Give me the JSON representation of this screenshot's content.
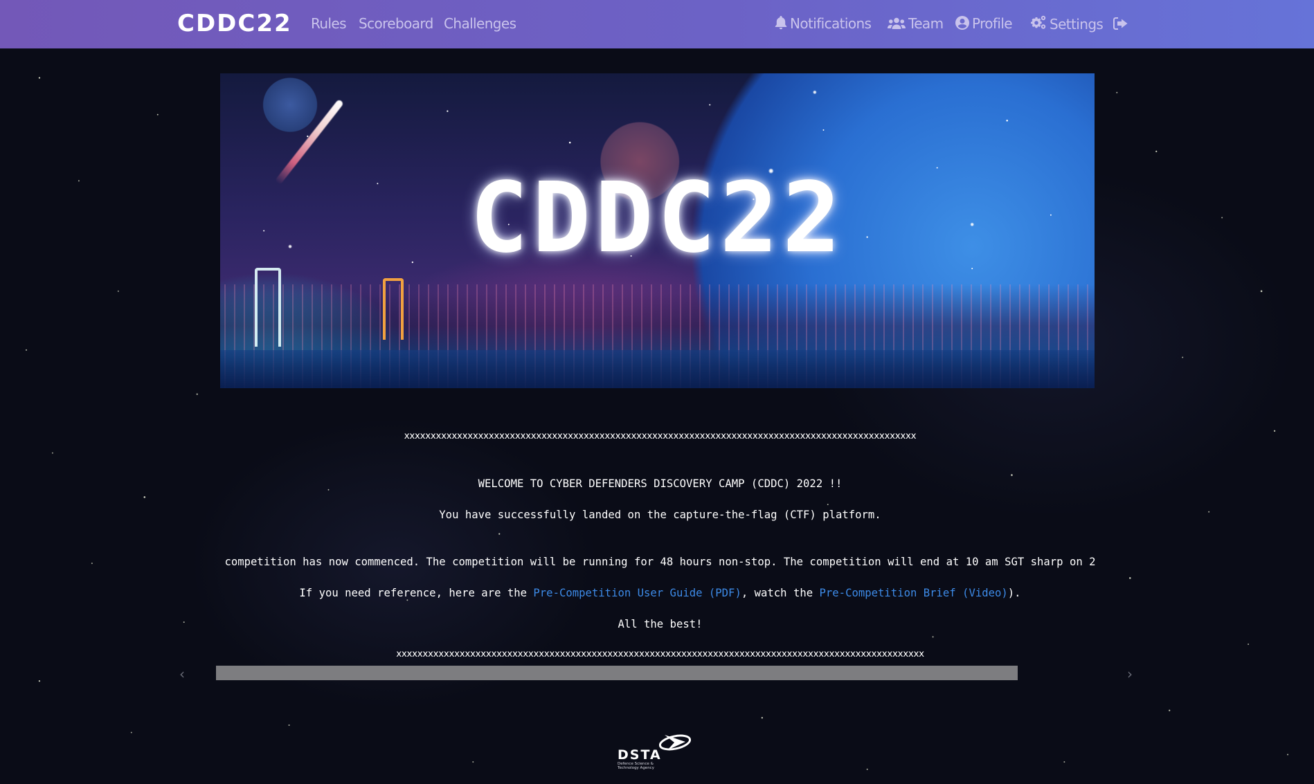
{
  "navbar": {
    "brand": "CDDC22",
    "left_links": [
      {
        "label": "Rules"
      },
      {
        "label": "Scoreboard"
      },
      {
        "label": "Challenges"
      }
    ],
    "right_links": [
      {
        "label": "Notifications",
        "icon": "bell-icon"
      },
      {
        "label": "Team",
        "icon": "users-icon"
      },
      {
        "label": "Profile",
        "icon": "user-circle-icon"
      },
      {
        "label": "Settings",
        "icon": "cogs-icon"
      },
      {
        "label": "",
        "icon": "logout-icon"
      }
    ],
    "colors": {
      "gradient_start": "#7358b8",
      "gradient_end": "#6673d8",
      "link": "#c9c3ec"
    }
  },
  "banner": {
    "title": "CDDC22"
  },
  "content": {
    "separator_top": "xxxxxxxxxxxxxxxxxxxxxxxxxxxxxxxxxxxxxxxxxxxxxxxxxxxxxxxxxxxxxxxxxxxxxxxxxxxxxxxxxxxxxxxxxxxxxxxxx",
    "welcome": "WELCOME TO CYBER DEFENDERS DISCOVERY CAMP (CDDC) 2022 !!",
    "landed": "You have successfully landed on the capture-the-flag (CTF) platform.",
    "competition": "competition has now commenced. The competition will be running for 48 hours non-stop. The competition will end at 10 am SGT sharp on 2",
    "reference_prefix": "If you need reference, here are the ",
    "guide_link": "Pre-Competition User Guide (PDF)",
    "reference_middle": ", watch the ",
    "brief_link": "Pre-Competition Brief (Video)",
    "reference_suffix": ").",
    "best": "All the best!",
    "separator_bottom": "xxxxxxxxxxxxxxxxxxxxxxxxxxxxxxxxxxxxxxxxxxxxxxxxxxxxxxxxxxxxxxxxxxxxxxxxxxxxxxxxxxxxxxxxxxxxxxxxxxxx",
    "link_color": "#3d8be8"
  },
  "scrollbar": {
    "left_arrow": "‹",
    "right_arrow": "›"
  },
  "footer": {
    "logo_word": "DSTA",
    "logo_sub_line1": "Defence Science &",
    "logo_sub_line2": "Technology Agency"
  }
}
